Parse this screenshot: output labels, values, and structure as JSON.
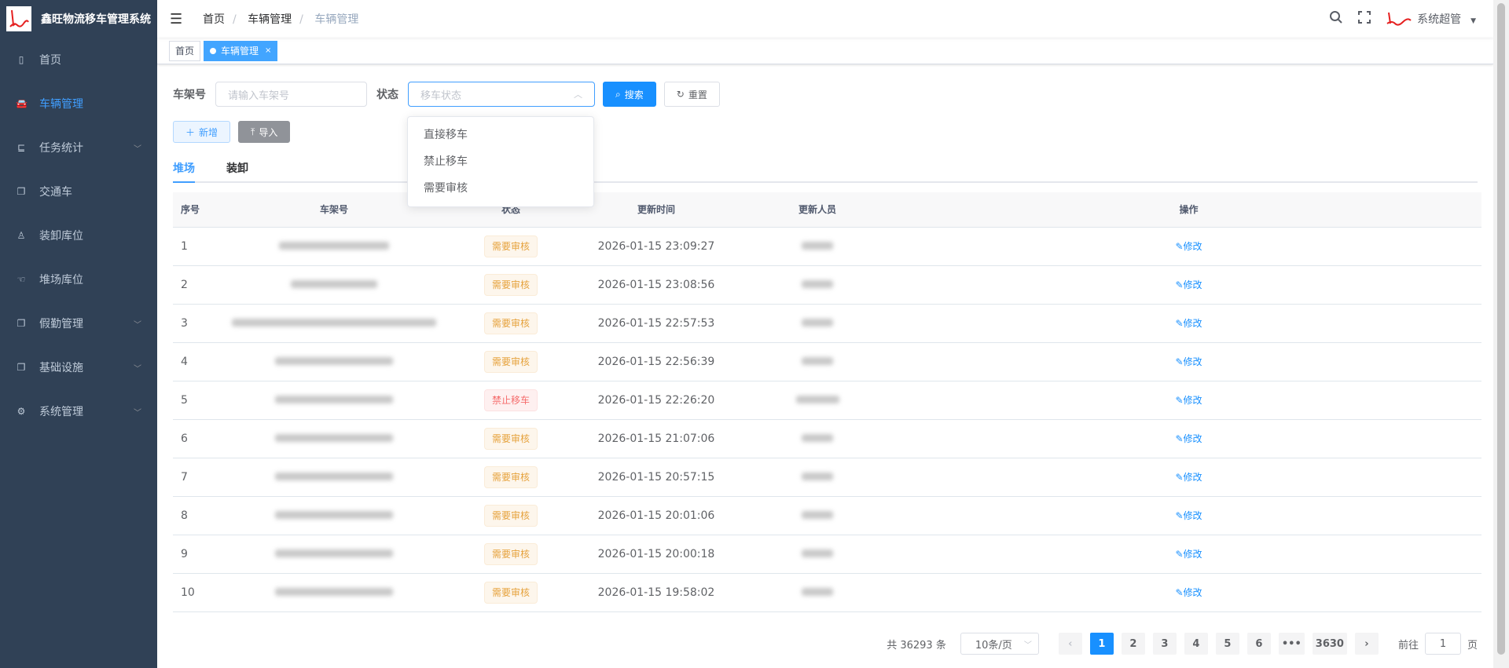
{
  "app": {
    "title": "鑫旺物流移车管理系统"
  },
  "sidebar": {
    "items": [
      {
        "label": "首页",
        "icon": "dashboard-icon"
      },
      {
        "label": "车辆管理",
        "icon": "car-icon",
        "active": true
      },
      {
        "label": "任务统计",
        "icon": "chart-icon",
        "expandable": true
      },
      {
        "label": "交通车",
        "icon": "copy-icon"
      },
      {
        "label": "装卸库位",
        "icon": "person-icon"
      },
      {
        "label": "堆场库位",
        "icon": "hand-icon"
      },
      {
        "label": "假勤管理",
        "icon": "copy-icon",
        "expandable": true
      },
      {
        "label": "基础设施",
        "icon": "copy-icon",
        "expandable": true
      },
      {
        "label": "系统管理",
        "icon": "gear-icon",
        "expandable": true
      }
    ]
  },
  "header": {
    "breadcrumb": [
      "首页",
      "车辆管理",
      "车辆管理"
    ],
    "user": "系统超管"
  },
  "tags": {
    "home": "首页",
    "current": "车辆管理"
  },
  "filters": {
    "vin_label": "车架号",
    "vin_placeholder": "请输入车架号",
    "status_label": "状态",
    "status_placeholder": "移车状态",
    "search": "搜索",
    "reset": "重置",
    "status_options": [
      "直接移车",
      "禁止移车",
      "需要审核"
    ]
  },
  "actions": {
    "add": "新增",
    "import": "导入"
  },
  "tabs": [
    "堆场",
    "装卸"
  ],
  "table": {
    "columns": [
      "序号",
      "车架号",
      "状态",
      "更新时间",
      "更新人员",
      "操作"
    ],
    "edit_label": "修改",
    "rows": [
      {
        "idx": "1",
        "status": "需要审核",
        "time": "2026-01-15 23:09:27"
      },
      {
        "idx": "2",
        "status": "需要审核",
        "time": "2026-01-15 23:08:56"
      },
      {
        "idx": "3",
        "status": "需要审核",
        "time": "2026-01-15 22:57:53"
      },
      {
        "idx": "4",
        "status": "需要审核",
        "time": "2026-01-15 22:56:39"
      },
      {
        "idx": "5",
        "status": "禁止移车",
        "time": "2026-01-15 22:26:20"
      },
      {
        "idx": "6",
        "status": "需要审核",
        "time": "2026-01-15 21:07:06"
      },
      {
        "idx": "7",
        "status": "需要审核",
        "time": "2026-01-15 20:57:15"
      },
      {
        "idx": "8",
        "status": "需要审核",
        "time": "2026-01-15 20:01:06"
      },
      {
        "idx": "9",
        "status": "需要审核",
        "time": "2026-01-15 20:00:18"
      },
      {
        "idx": "10",
        "status": "需要审核",
        "time": "2026-01-15 19:58:02"
      }
    ]
  },
  "pagination": {
    "total": "共 36293 条",
    "page_size": "10条/页",
    "pages": [
      "1",
      "2",
      "3",
      "4",
      "5",
      "6",
      "•••",
      "3630"
    ],
    "current": "1",
    "goto_label": "前往",
    "goto_value": "1",
    "page_unit": "页"
  },
  "colors": {
    "sidebar": "#304156",
    "primary": "#1890ff",
    "warning": "#e6a23c",
    "danger": "#f56c6c"
  }
}
